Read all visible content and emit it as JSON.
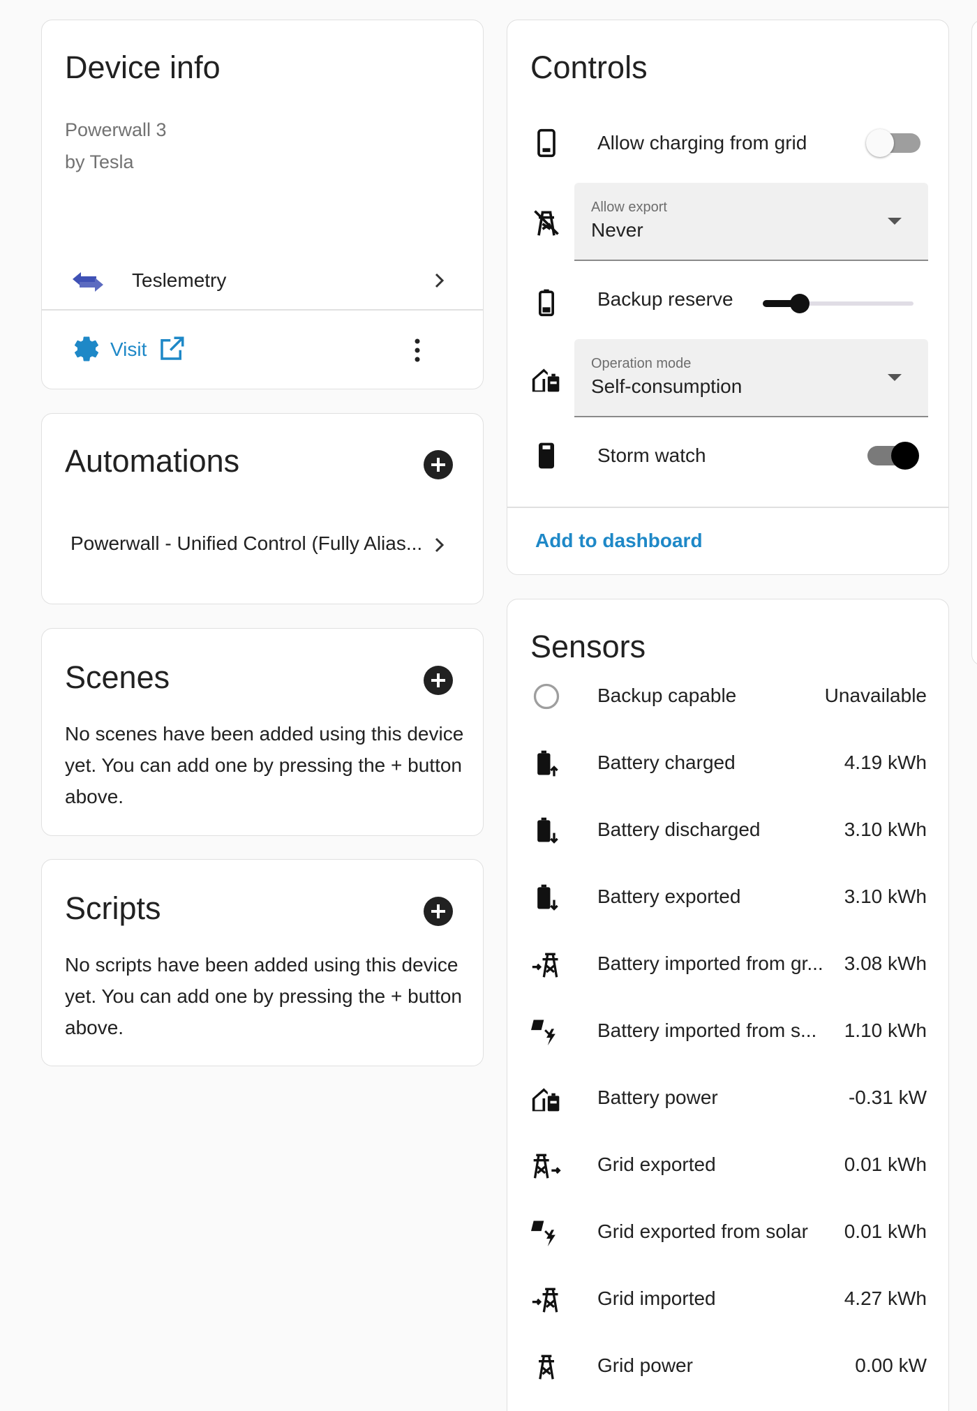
{
  "device_info": {
    "title": "Device info",
    "model": "Powerwall 3",
    "manufacturer": "by Tesla",
    "integration": "Teslemetry",
    "visit_label": "Visit"
  },
  "automations": {
    "title": "Automations",
    "items": [
      "Powerwall - Unified Control (Fully Alias..."
    ]
  },
  "scenes": {
    "title": "Scenes",
    "empty_text": "No scenes have been added using this device yet. You can add one by pressing the + button above."
  },
  "scripts": {
    "title": "Scripts",
    "empty_text": "No scripts have been added using this device yet. You can add one by pressing the + button above."
  },
  "controls": {
    "title": "Controls",
    "allow_charging": {
      "label": "Allow charging from grid",
      "on": false,
      "icon": "phone-battery-icon"
    },
    "allow_export": {
      "label": "Allow export",
      "value": "Never",
      "icon": "transmission-tower-off-icon"
    },
    "backup_reserve": {
      "label": "Backup reserve",
      "level": 0.2,
      "icon": "battery-icon"
    },
    "operation_mode": {
      "label": "Operation mode",
      "value": "Self-consumption",
      "icon": "home-battery-icon"
    },
    "storm_watch": {
      "label": "Storm watch",
      "on": true,
      "icon": "battery-tall-icon"
    },
    "add_to_dashboard": "Add to dashboard"
  },
  "sensors": {
    "title": "Sensors",
    "rows": [
      {
        "label": "Backup capable",
        "value": "Unavailable",
        "icon": "circle-outline-icon"
      },
      {
        "label": "Battery charged",
        "value": "4.19 kWh",
        "icon": "battery-arrow-up-icon"
      },
      {
        "label": "Battery discharged",
        "value": "3.10 kWh",
        "icon": "battery-arrow-down-icon"
      },
      {
        "label": "Battery exported",
        "value": "3.10 kWh",
        "icon": "battery-arrow-down-icon"
      },
      {
        "label": "Battery imported from gr...",
        "value": "3.08 kWh",
        "icon": "transmission-tower-import-icon"
      },
      {
        "label": "Battery imported from s...",
        "value": "1.10 kWh",
        "icon": "solar-power-icon"
      },
      {
        "label": "Battery power",
        "value": "-0.31 kW",
        "icon": "home-battery-icon"
      },
      {
        "label": "Grid exported",
        "value": "0.01 kWh",
        "icon": "transmission-tower-export-icon"
      },
      {
        "label": "Grid exported from solar",
        "value": "0.01 kWh",
        "icon": "solar-power-icon"
      },
      {
        "label": "Grid imported",
        "value": "4.27 kWh",
        "icon": "transmission-tower-import-icon"
      },
      {
        "label": "Grid power",
        "value": "0.00 kW",
        "icon": "transmission-tower-icon"
      }
    ]
  },
  "colors": {
    "accent": "#1e88c7",
    "integration_logo": "#3f51b5",
    "toggle_on": "#111111",
    "toggle_off_track": "#9e9e9e"
  }
}
